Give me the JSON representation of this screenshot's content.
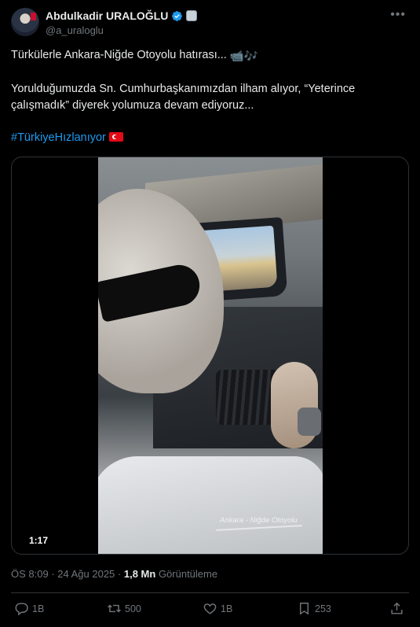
{
  "author": {
    "name": "Abdulkadir URALOĞLU",
    "handle": "@a_uraloglu",
    "verified_icon": "verified-badge-icon",
    "affiliation_icon": "government-badge-icon"
  },
  "tweet": {
    "line1": "Türkülerle Ankara-Niğde Otoyolu hatırası... ",
    "line1_emojis": "📹🎶",
    "line2": "Yorulduğumuzda Sn. Cumhurbaşkanımızdan ilham alıyor, “Yeterince çalışmadık” diyerek yolumuza devam ediyoruz...",
    "hashtag": "#TürkiyeHızlanıyor"
  },
  "video": {
    "duration": "1:17",
    "watermark": "Ankara - Niğde Otoyolu"
  },
  "meta": {
    "time": "ÖS 8:09",
    "separator": " · ",
    "date": "24 Ağu 2025",
    "views": "1,8 Mn",
    "views_label": " Görüntüleme"
  },
  "actions": {
    "replies": "1B",
    "reposts": "500",
    "likes": "1B",
    "bookmarks": "253"
  },
  "colors": {
    "background": "#000000",
    "text": "#e7e9ea",
    "secondary": "#71767b",
    "link": "#1d9bf0",
    "verified": "#1d9bf0"
  }
}
